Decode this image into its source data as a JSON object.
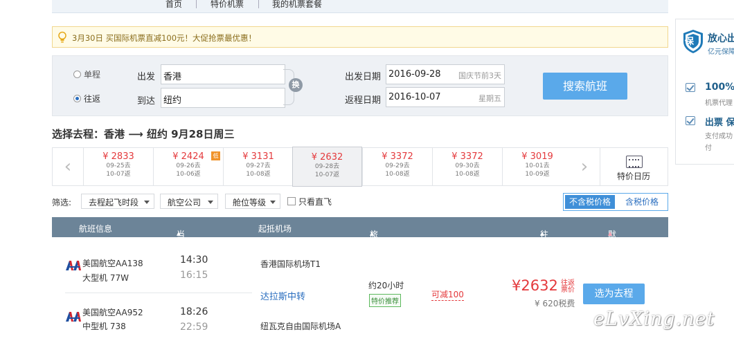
{
  "nav": {
    "items": [
      "首页",
      "特价机票",
      "我的机票套餐"
    ]
  },
  "promo": {
    "text": "3月30日 买国际机票直减100元！大促抢票最优惠！"
  },
  "search": {
    "trip_types": [
      "单程",
      "往返"
    ],
    "selected_trip_type": "往返",
    "from_label": "出发",
    "from_value": "香港",
    "to_label": "到达",
    "to_value": "纽约",
    "swap_label": "换",
    "depart_label": "出发日期",
    "depart_value": "2016-09-28",
    "depart_hint": "国庆节前3天",
    "return_label": "返程日期",
    "return_value": "2016-10-07",
    "return_hint": "星期五",
    "button": "搜索航班"
  },
  "route_title": "选择去程：香港 ⟶ 纽约  9月28日周三",
  "date_strip": {
    "days": [
      {
        "price": "¥ 2833",
        "depart": "09-25去",
        "return": "10-07返"
      },
      {
        "price": "¥ 2424",
        "depart": "09-26去",
        "return": "10-06返",
        "badge": "低"
      },
      {
        "price": "¥ 3131",
        "depart": "09-27去",
        "return": "10-08返"
      },
      {
        "price": "¥ 2632",
        "depart": "09-28去",
        "return": "10-07返",
        "active": true
      },
      {
        "price": "¥ 3372",
        "depart": "09-29去",
        "return": "10-08返"
      },
      {
        "price": "¥ 3372",
        "depart": "09-30去",
        "return": "10-08返"
      },
      {
        "price": "¥ 3019",
        "depart": "10-01去",
        "return": "10-09返"
      }
    ],
    "calendar_label": "特价日历"
  },
  "filters": {
    "label": "筛选:",
    "dropdowns": [
      "去程起飞时段",
      "航空公司",
      "舱位等级"
    ],
    "direct_only": "只看直飞",
    "tax_excluded": "不含税价格",
    "tax_included": "含税价格"
  },
  "results_header": {
    "flight_info": "航班信息",
    "times": "当地起降时间",
    "airports": "起抵机场",
    "duration": "旅行总时长",
    "price": "往返 价格",
    "sort": "默认排序"
  },
  "results": [
    {
      "airline": "美国航空AA138",
      "aircraft": "大型机 77W",
      "dep_time": "14:30",
      "arr_time": "16:15",
      "dep_airport": "香港国际机场T1",
      "transfer": "达拉斯中转",
      "duration": "约20小时",
      "tag": "特价推荐",
      "discount": "可减100",
      "price": "¥2632",
      "price_note_1": "往返",
      "price_note_2": "票价",
      "tax": "¥ 620税费",
      "select": "选为去程"
    },
    {
      "airline": "美国航空AA952",
      "aircraft": "中型机 738",
      "dep_time": "18:26",
      "arr_time": "22:59",
      "arr_airport": "纽瓦克自由国际机场A"
    }
  ],
  "sidebar": {
    "logo_char": "保",
    "title": "放心出",
    "subtitle": "亿元保障",
    "feature1_title": "100%",
    "feature1_desc": "机票代理",
    "feature2_title": "出票 保",
    "feature2_desc1": "支付成功",
    "feature2_desc2": "付"
  },
  "watermark": "eLvXing.net",
  "colors": {
    "accent_blue": "#5aa9ea",
    "price_red": "#e4393c",
    "header_slate": "#6c8498",
    "promo_bg": "#fffbe6"
  }
}
